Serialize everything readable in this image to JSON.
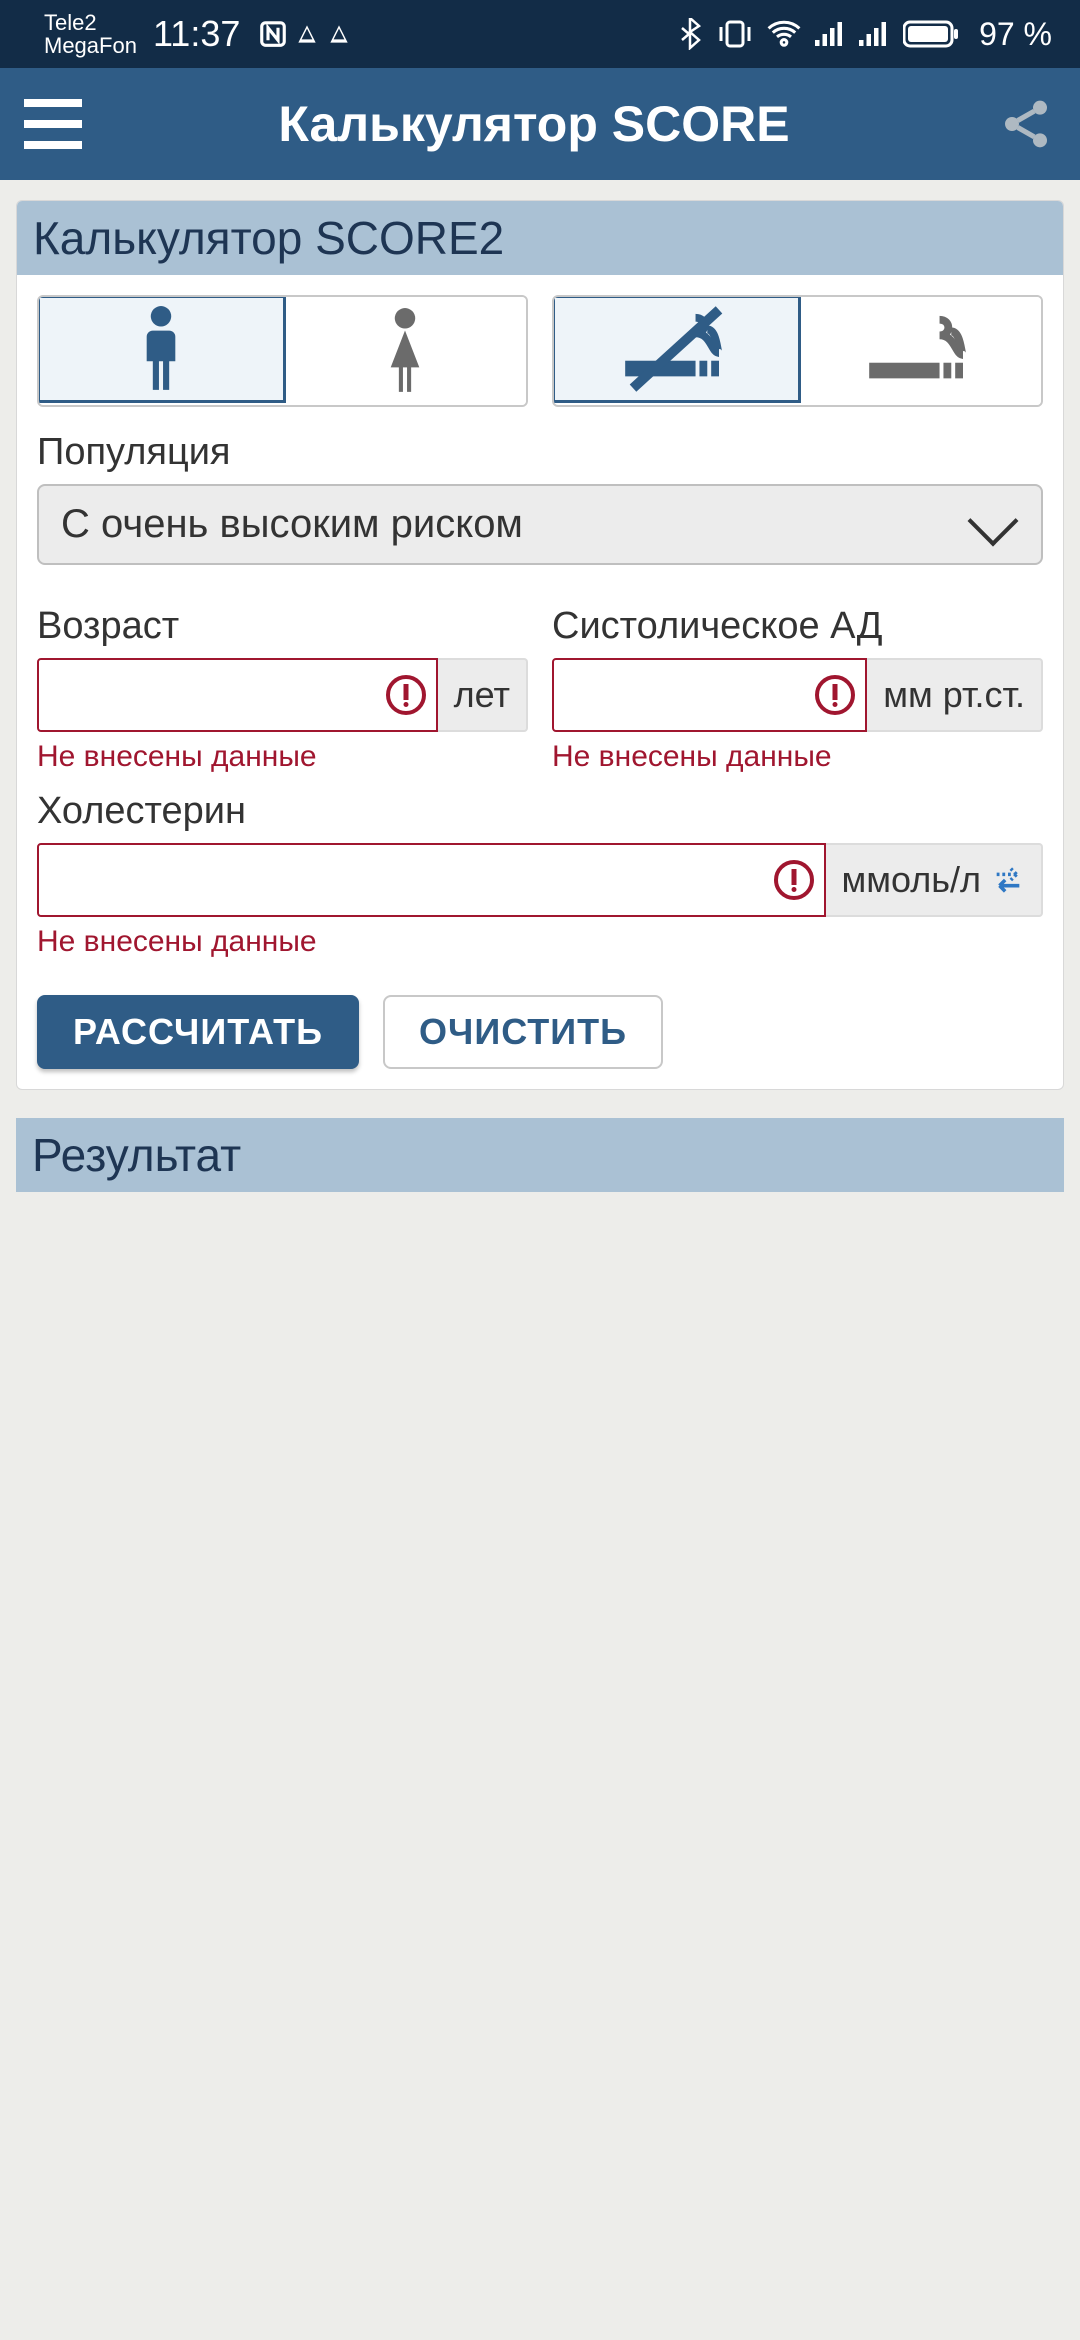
{
  "statusbar": {
    "carrier1": "Tele2",
    "carrier2": "MegaFon",
    "time": "11:37",
    "battery_text": "97 %"
  },
  "appbar": {
    "title": "Калькулятор SCORE"
  },
  "form": {
    "section_title": "Калькулятор SCORE2",
    "population_label": "Популяция",
    "population_value": "С очень высоким риском",
    "age_label": "Возраст",
    "age_unit": "лет",
    "bp_label": "Систолическое АД",
    "bp_unit": "мм рт.ст.",
    "chol_label": "Холестерин",
    "chol_unit": "ммоль/л",
    "error_text": "Не внесены данные",
    "calculate_btn": "РАССЧИТАТЬ",
    "clear_btn": "ОЧИСТИТЬ"
  },
  "result": {
    "title": "Результат"
  }
}
